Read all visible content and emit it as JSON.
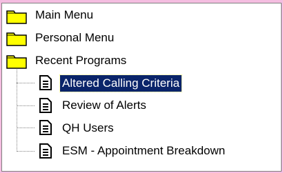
{
  "tree": {
    "folders": [
      {
        "label": "Main Menu",
        "icon": "folder-icon"
      },
      {
        "label": "Personal Menu",
        "icon": "folder-icon"
      },
      {
        "label": "Recent Programs",
        "icon": "folder-open-icon"
      }
    ],
    "programs": [
      {
        "label": "Altered Calling Criteria",
        "icon": "document-icon",
        "selected": true
      },
      {
        "label": "Review of Alerts",
        "icon": "document-icon",
        "selected": false
      },
      {
        "label": "QH Users",
        "icon": "document-icon",
        "selected": false
      },
      {
        "label": "ESM - Appointment Breakdown",
        "icon": "document-icon",
        "selected": false
      }
    ]
  },
  "colors": {
    "background": "#f4bde0",
    "selection": "#0a246a",
    "folder": "#ffff00"
  }
}
